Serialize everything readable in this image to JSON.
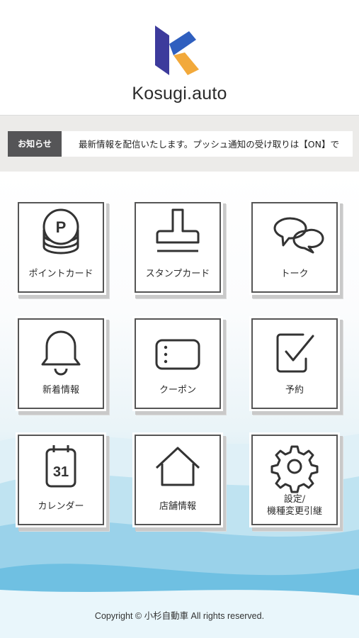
{
  "brand": {
    "name": "Kosugi.auto",
    "colors": {
      "blue": "#3d3b9c",
      "orange": "#f2a93b"
    }
  },
  "news": {
    "tag": "お知らせ",
    "text": "最新情報を配信いたします。プッシュ通知の受け取りは【ON】で"
  },
  "menu": [
    {
      "label": "ポイントカード",
      "icon": "point-coins-icon"
    },
    {
      "label": "スタンプカード",
      "icon": "stamp-icon"
    },
    {
      "label": "トーク",
      "icon": "chat-bubbles-icon"
    },
    {
      "label": "新着情報",
      "icon": "bell-icon"
    },
    {
      "label": "クーポン",
      "icon": "coupon-ticket-icon"
    },
    {
      "label": "予約",
      "icon": "checkbox-icon"
    },
    {
      "label": "カレンダー",
      "icon": "calendar-icon",
      "calendar_day": "31"
    },
    {
      "label": "店舗情報",
      "icon": "house-icon"
    },
    {
      "label_line1": "設定/",
      "label_line2": "機種変更引継",
      "icon": "gear-icon"
    }
  ],
  "footer": {
    "copyright": "Copyright © 小杉自動車 All rights reserved."
  }
}
